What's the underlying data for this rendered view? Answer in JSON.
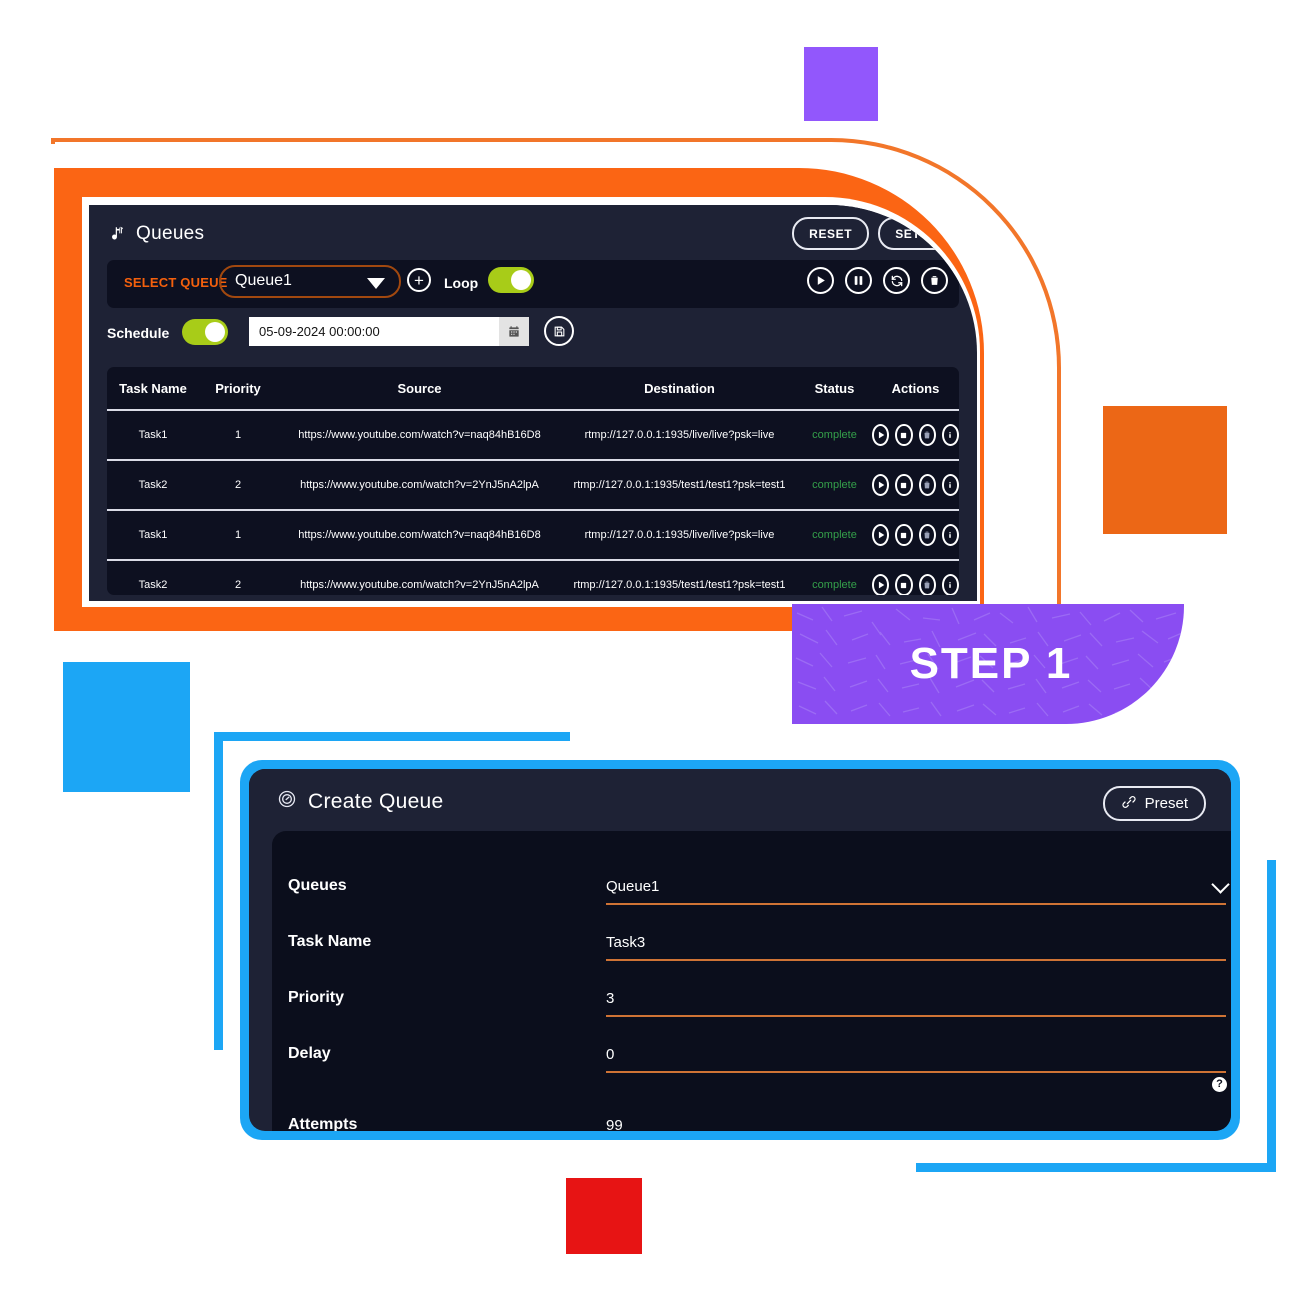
{
  "queues_panel": {
    "title": "Queues",
    "title_icon": "music-note-icon",
    "header_buttons": [
      {
        "label": "RESET",
        "name": "reset-button"
      },
      {
        "label": "SETTINGS",
        "name": "settings-button"
      }
    ],
    "toolbar": {
      "select_queue_label": "SELECT QUEUE",
      "selected_queue": "Queue1",
      "add_button_label": "+",
      "loop_label": "Loop",
      "loop_on": true,
      "actions": [
        "play-icon",
        "pause-icon",
        "refresh-icon",
        "trash-icon"
      ]
    },
    "schedule": {
      "label": "Schedule",
      "enabled": true,
      "datetime": "05-09-2024 00:00:00",
      "calendar_icon": "calendar-icon",
      "save_icon": "save-disk-icon"
    },
    "table": {
      "columns": [
        "Task Name",
        "Priority",
        "Source",
        "Destination",
        "Status",
        "Actions"
      ],
      "rows": [
        {
          "task_name": "Task1",
          "priority": "1",
          "source": "https://www.youtube.com/watch?v=naq84hB16D8",
          "destination": "rtmp://127.0.0.1:1935/live/live?psk=live",
          "status": "complete"
        },
        {
          "task_name": "Task2",
          "priority": "2",
          "source": "https://www.youtube.com/watch?v=2YnJ5nA2lpA",
          "destination": "rtmp://127.0.0.1:1935/test1/test1?psk=test1",
          "status": "complete"
        },
        {
          "task_name": "Task1",
          "priority": "1",
          "source": "https://www.youtube.com/watch?v=naq84hB16D8",
          "destination": "rtmp://127.0.0.1:1935/live/live?psk=live",
          "status": "complete"
        },
        {
          "task_name": "Task2",
          "priority": "2",
          "source": "https://www.youtube.com/watch?v=2YnJ5nA2lpA",
          "destination": "rtmp://127.0.0.1:1935/test1/test1?psk=test1",
          "status": "complete"
        }
      ],
      "row_actions": [
        "play-icon",
        "stop-icon",
        "trash-icon",
        "info-icon"
      ]
    }
  },
  "step_badge": {
    "label": "STEP 1",
    "color": "#8a4df2"
  },
  "create_queue": {
    "title": "Create Queue",
    "title_icon": "clock-dial-icon",
    "preset_button": {
      "label": "Preset",
      "icon": "link-chain-icon"
    },
    "fields": [
      {
        "label": "Queues",
        "value": "Queue1",
        "type": "select",
        "help": false
      },
      {
        "label": "Task Name",
        "value": "Task3",
        "type": "text",
        "help": false
      },
      {
        "label": "Priority",
        "value": "3",
        "type": "text",
        "help": false
      },
      {
        "label": "Delay",
        "value": "0",
        "type": "text",
        "help": true
      },
      {
        "label": "Attempts",
        "value": "99",
        "type": "text",
        "help": true
      }
    ]
  },
  "decor": {
    "purple_square": "#9257fc",
    "orange_square": "#ec6716",
    "blue_square": "#1ca6f5",
    "red_square": "#e71414",
    "orange_frame": "#fb6514",
    "blue_frame": "#1ca6f5"
  }
}
